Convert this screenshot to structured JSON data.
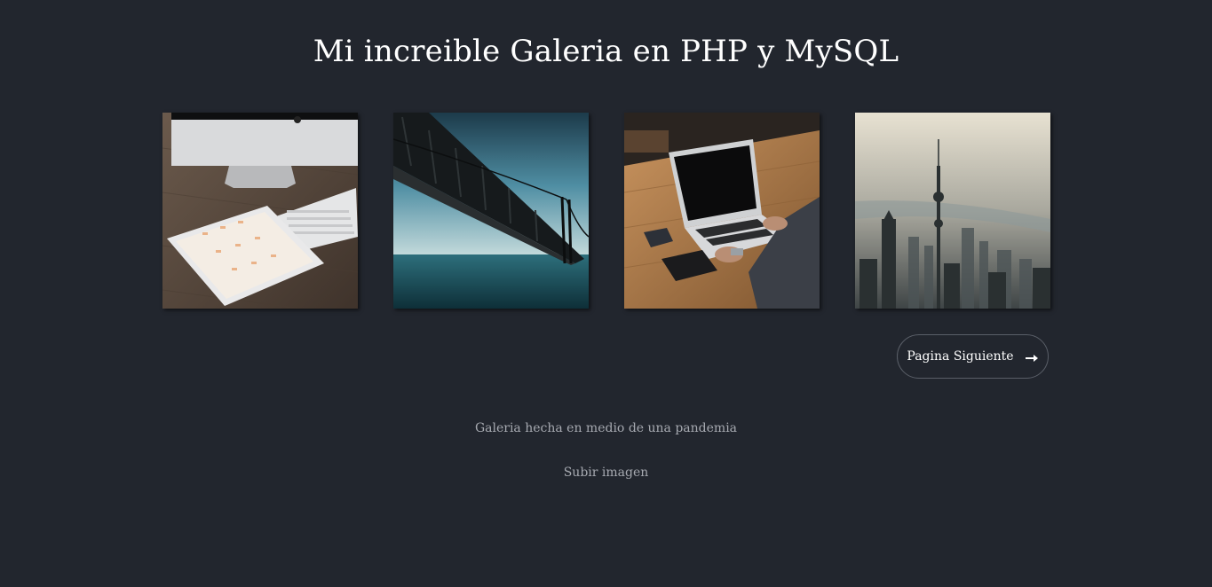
{
  "page": {
    "title": "Mi increible Galeria en PHP y MySQL"
  },
  "gallery": {
    "images": [
      {
        "icon": "desk-imac-ipad-photo"
      },
      {
        "icon": "bridge-over-sea-photo"
      },
      {
        "icon": "laptop-on-table-photo"
      },
      {
        "icon": "city-skyline-fog-photo"
      }
    ]
  },
  "pagination": {
    "next_label": "Pagina Siguiente",
    "next_icon": "arrow-right-icon"
  },
  "footer": {
    "credits": "Galeria hecha en medio de una pandemia",
    "upload_link": "Subir imagen"
  },
  "colors": {
    "background": "#22262e",
    "title": "#ffffff",
    "muted_text": "#a6a9b0",
    "button_border": "#5a5f68"
  }
}
